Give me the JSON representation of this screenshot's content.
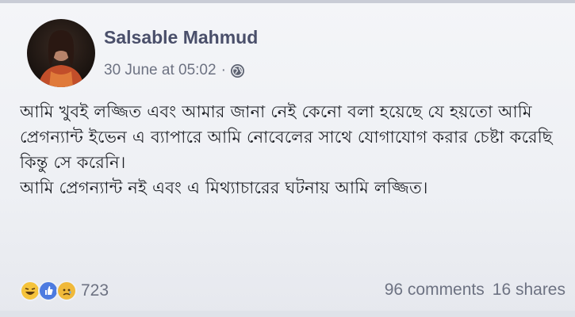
{
  "post": {
    "author": "Salsable Mahmud",
    "timestamp": "30 June at 05:02",
    "separator": "·",
    "privacy_icon": "globe-icon",
    "body_lines": [
      "আমি খুবই লজ্জিত এবং আমার জানা নেই কেনো বলা হয়েছে যে হয়তো আমি",
      "প্রেগন্যান্ট ইভেন এ ব্যাপারে আমি নোবেলের সাথে যোগাযোগ করার চেষ্টা করেছি",
      "কিন্তু সে করেনি।",
      "আমি প্রেগন্যান্ট নই এবং এ মিথ্যাচারের ঘটনায় আমি লজ্জিত।"
    ]
  },
  "footer": {
    "reaction_icons": [
      "haha-icon",
      "like-icon",
      "sad-icon"
    ],
    "reaction_count": "723",
    "comments": "96 comments",
    "shares": "16 shares"
  },
  "colors": {
    "author": "#4a4f6a",
    "meta": "#6d7282",
    "body_text": "#1e2026",
    "like_blue": "#4d7be0",
    "emoji_yellow": "#f5c33b"
  }
}
